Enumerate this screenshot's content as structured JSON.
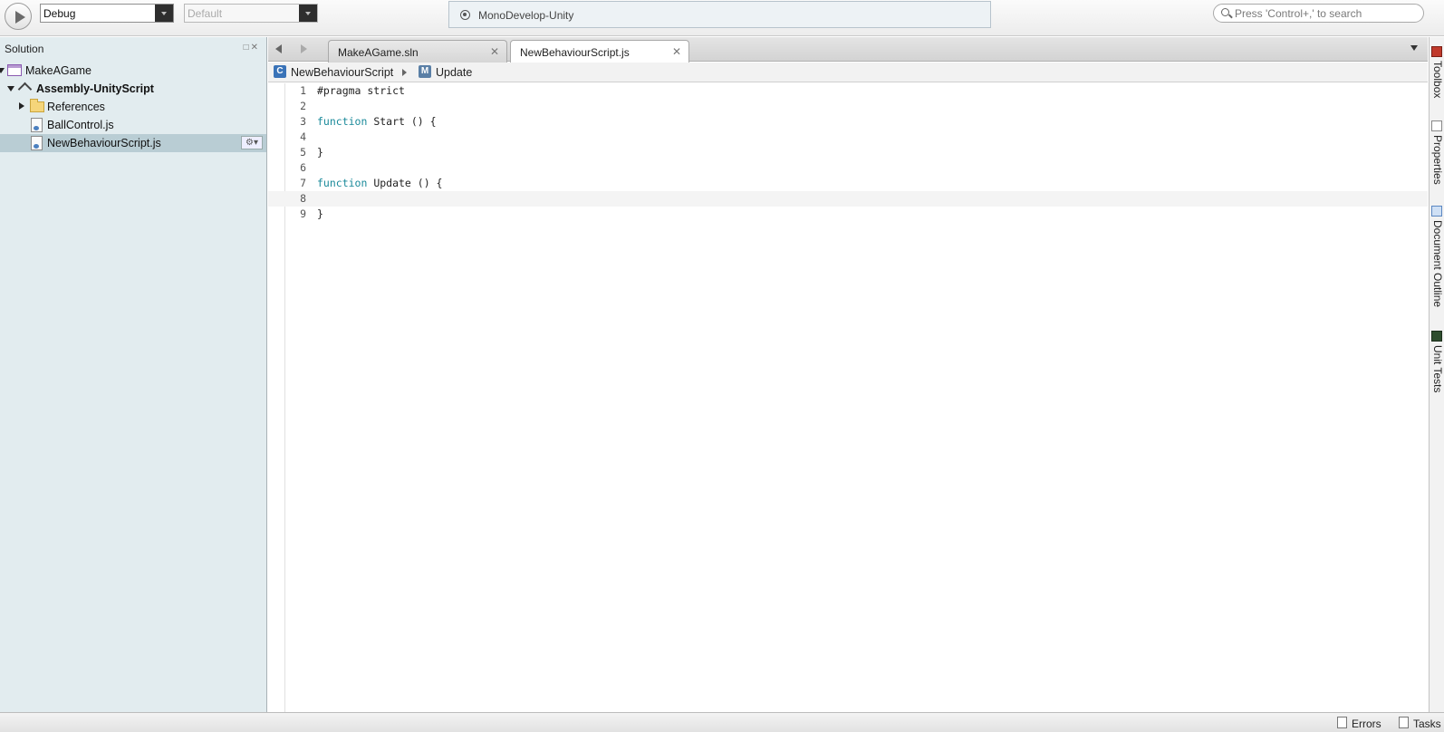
{
  "toolbar": {
    "config_value": "Debug",
    "platform_value": "Default",
    "status_text": "MonoDevelop-Unity",
    "search_placeholder": "Press 'Control+,' to search"
  },
  "solution_pad": {
    "title": "Solution",
    "items": [
      {
        "label": "MakeAGame"
      },
      {
        "label": "Assembly-UnityScript"
      },
      {
        "label": "References"
      },
      {
        "label": "BallControl.js"
      },
      {
        "label": "NewBehaviourScript.js"
      }
    ]
  },
  "tabs": [
    {
      "label": "MakeAGame.sln",
      "active": false
    },
    {
      "label": "NewBehaviourScript.js",
      "active": true
    }
  ],
  "breadcrumb": {
    "class_name": "NewBehaviourScript",
    "member_name": "Update",
    "class_icon": "C",
    "member_icon": "M"
  },
  "editor": {
    "lines": [
      {
        "n": "1",
        "kind": "pp",
        "text": "#pragma strict"
      },
      {
        "n": "2",
        "text": ""
      },
      {
        "n": "3",
        "kw": "function",
        "rest": " Start () {"
      },
      {
        "n": "4",
        "text": ""
      },
      {
        "n": "5",
        "text": "}"
      },
      {
        "n": "6",
        "text": ""
      },
      {
        "n": "7",
        "kw": "function",
        "rest": " Update () {"
      },
      {
        "n": "8",
        "text": ""
      },
      {
        "n": "9",
        "text": "}"
      }
    ],
    "current_line": 8
  },
  "right_dock": [
    {
      "label": "Toolbox",
      "icon": "toolbox-icon"
    },
    {
      "label": "Properties",
      "icon": "properties-icon"
    },
    {
      "label": "Document Outline",
      "icon": "document-outline-icon"
    },
    {
      "label": "Unit Tests",
      "icon": "unit-tests-icon"
    }
  ],
  "statusbar": {
    "errors_label": "Errors",
    "tasks_label": "Tasks"
  }
}
